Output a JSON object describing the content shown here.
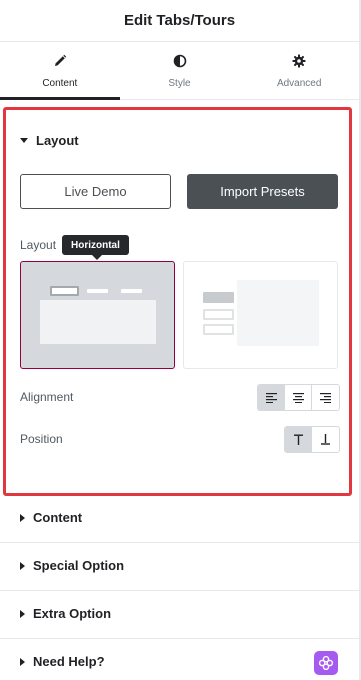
{
  "header": {
    "title": "Edit Tabs/Tours"
  },
  "tabs": [
    {
      "label": "Content",
      "icon": "pencil-icon",
      "active": true
    },
    {
      "label": "Style",
      "icon": "contrast-icon",
      "active": false
    },
    {
      "label": "Advanced",
      "icon": "gear-icon",
      "active": false
    }
  ],
  "layout_section": {
    "title": "Layout",
    "live_demo_label": "Live Demo",
    "import_presets_label": "Import Presets",
    "layout_label": "Layout",
    "tooltip": "Horizontal",
    "layout_options": [
      "horizontal",
      "vertical"
    ],
    "selected_layout": "horizontal",
    "alignment_label": "Alignment",
    "alignment_options": [
      "align-left-icon",
      "align-center-icon",
      "align-right-icon"
    ],
    "selected_alignment": "align-left-icon",
    "position_label": "Position",
    "position_options": [
      "align-top-icon",
      "align-bottom-icon"
    ],
    "selected_position": "align-top-icon"
  },
  "sections": [
    {
      "title": "Content"
    },
    {
      "title": "Special Option"
    },
    {
      "title": "Extra Option"
    },
    {
      "title": "Need Help?"
    }
  ],
  "colors": {
    "highlight_border": "#e0383e",
    "selected_card_border": "#93003f",
    "primary_button": "#4b5055",
    "help_badge": "#a55bf0"
  }
}
